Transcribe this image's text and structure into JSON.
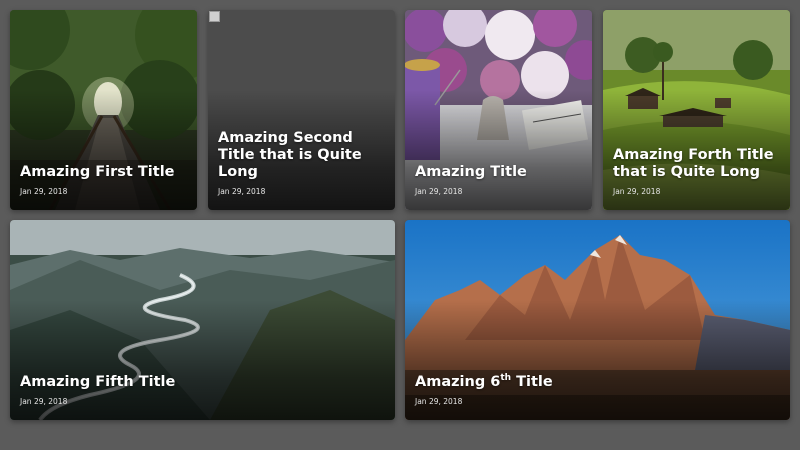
{
  "cards": [
    {
      "title": "Amazing First Title",
      "date": "Jan 29, 2018",
      "image": "boardwalk-forest"
    },
    {
      "title": "Amazing Second Title that is Quite Long",
      "date": "Jan 29, 2018",
      "image": "broken-image"
    },
    {
      "title": "Amazing Title",
      "date": "Jan 29, 2018",
      "image": "roses-thimble-sewing"
    },
    {
      "title": "Amazing Forth Title that is Quite Long",
      "date": "Jan 29, 2018",
      "image": "rice-terraces-huts"
    },
    {
      "title": "Amazing Fifth Title",
      "date": "Jan 29, 2018",
      "image": "river-valley-mountains"
    },
    {
      "title_pre": "Amazing 6",
      "title_sup": "th",
      "title_post": " Title",
      "date": "Jan 29, 2018",
      "image": "snowy-mountain-peaks"
    }
  ]
}
